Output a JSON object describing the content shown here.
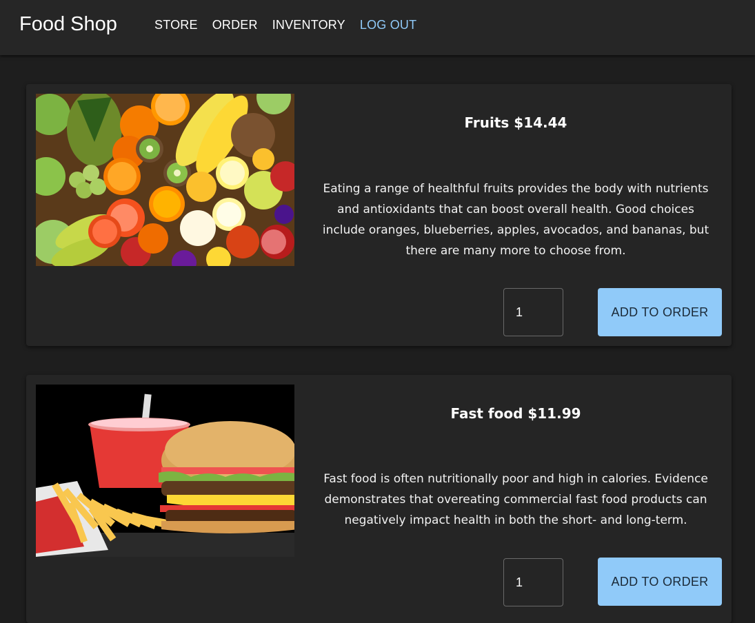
{
  "app": {
    "title": "Food Shop",
    "nav": [
      "STORE",
      "ORDER",
      "INVENTORY",
      "LOG OUT"
    ]
  },
  "colors": {
    "background": "#1e1e1e",
    "card": "#252525",
    "accent": "#90caf9"
  },
  "products": [
    {
      "title": "Fruits $14.44",
      "description_lines": [
        "Eating a range of healthful fruits provides the body with nutrients",
        "and antioxidants that can boost overall health. Good choices",
        "include oranges, blueberries, apples, avocados, and bananas, but",
        "there are many more to choose from."
      ],
      "quantity": "1",
      "button": "ADD TO ORDER"
    },
    {
      "title": "Fast food $11.99",
      "description_lines": [
        "Fast food is often nutritionally poor and high in calories. Evidence",
        "demonstrates that overeating commercial fast food products can",
        "negatively impact health in both the short- and long-term."
      ],
      "quantity": "1",
      "button": "ADD TO ORDER"
    }
  ]
}
